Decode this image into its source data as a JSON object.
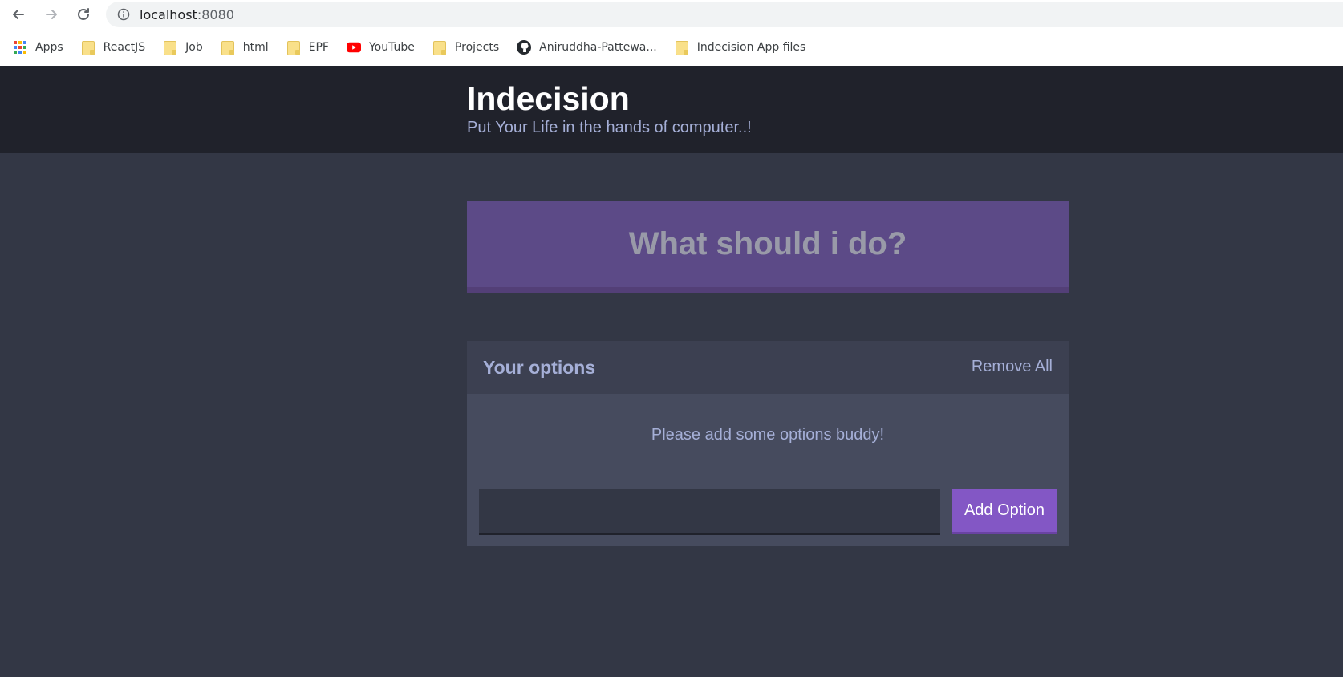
{
  "browser": {
    "url_host": "localhost",
    "url_port": ":8080",
    "bookmarks": [
      {
        "label": "Apps",
        "icon": "apps-grid-icon"
      },
      {
        "label": "ReactJS",
        "icon": "folder-icon"
      },
      {
        "label": "Job",
        "icon": "folder-icon"
      },
      {
        "label": "html",
        "icon": "folder-icon"
      },
      {
        "label": "EPF",
        "icon": "folder-icon"
      },
      {
        "label": "YouTube",
        "icon": "youtube-icon"
      },
      {
        "label": "Projects",
        "icon": "folder-icon"
      },
      {
        "label": "Aniruddha-Pattewa...",
        "icon": "github-icon"
      },
      {
        "label": "Indecision App files",
        "icon": "folder-icon"
      }
    ]
  },
  "app": {
    "title": "Indecision",
    "subtitle": "Put Your Life in the hands of computer..!",
    "decide_button": "What should i do?",
    "options": {
      "header": "Your options",
      "remove_all": "Remove All",
      "empty_message": "Please add some options buddy!",
      "input_value": "",
      "add_button": "Add Option"
    }
  },
  "colors": {
    "header_bg": "#20222b",
    "body_bg": "#333745",
    "purple_button": "#5c4a87",
    "add_button": "#8357c5",
    "accent_text": "#a5afd7"
  }
}
